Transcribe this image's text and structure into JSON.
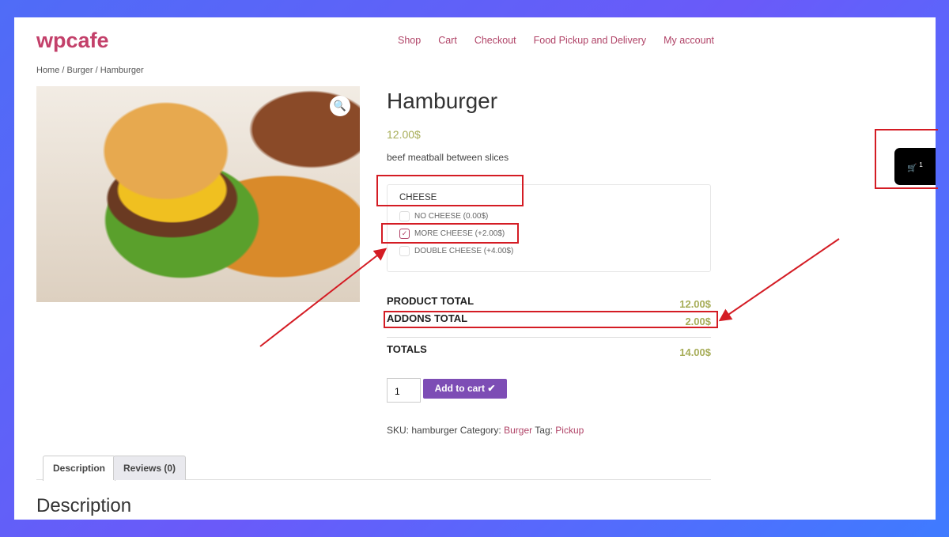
{
  "site": {
    "logo": "wpcafe",
    "nav": [
      "Shop",
      "Cart",
      "Checkout",
      "Food Pickup and Delivery",
      "My account"
    ]
  },
  "breadcrumb": "Home / Burger / Hamburger",
  "product": {
    "title": "Hamburger",
    "price": "12.00$",
    "description": "beef meatball between slices"
  },
  "addons": {
    "title": "CHEESE",
    "options": [
      {
        "label": "NO CHEESE (0.00$)",
        "checked": false
      },
      {
        "label": "MORE CHEESE (+2.00$)",
        "checked": true
      },
      {
        "label": "DOUBLE CHEESE (+4.00$)",
        "checked": false
      }
    ]
  },
  "totals": {
    "product_label": "PRODUCT TOTAL",
    "product_value": "12.00$",
    "addons_label": "ADDONS TOTAL",
    "addons_value": "2.00$",
    "total_label": "TOTALS",
    "total_value": "14.00$"
  },
  "cart": {
    "quantity": "1",
    "add_label": "Add to cart",
    "count": "1"
  },
  "meta": {
    "sku_label": "SKU:",
    "sku": "hamburger",
    "category_label": "Category:",
    "category": "Burger",
    "tag_label": "Tag:",
    "tag": "Pickup"
  },
  "tabs": [
    "Description",
    "Reviews (0)"
  ],
  "section_title": "Description",
  "colors": {
    "accent": "#b04367",
    "button": "#7d4db5",
    "price": "#a7ad58",
    "annotation": "#d41c24"
  }
}
